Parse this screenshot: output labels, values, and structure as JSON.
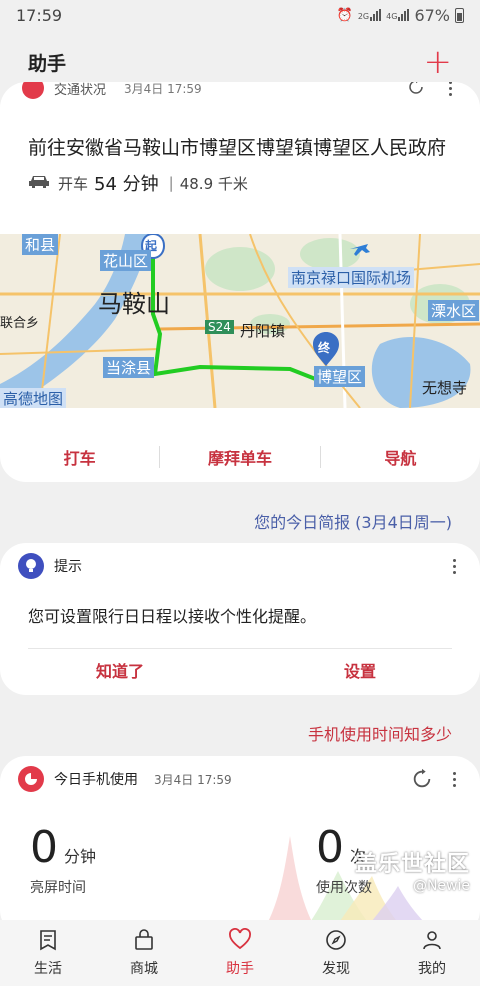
{
  "status_bar": {
    "time": "17:59",
    "battery": "67%",
    "sig1": "2G",
    "sig2": "4G"
  },
  "header": {
    "title": "助手",
    "add_icon": "add-circle-icon"
  },
  "traffic_card": {
    "category": "交通状况",
    "timestamp": "3月4日 17:59",
    "destination": "前往安徽省马鞍山市博望区博望镇博望区人民政府",
    "mode": "开车",
    "duration": "54 分钟",
    "distance": "48.9 千米",
    "map_labels": {
      "hexian": "和县",
      "huashanqu": "花山区",
      "maanshan": "马鞍山",
      "lukou": "南京禄口国际机场",
      "lishui": "溧水区",
      "lianhexiang": "联合乡",
      "s24": "S24",
      "danyang": "丹阳镇",
      "dangtu": "当涂县",
      "bowang": "博望区",
      "wuxiang": "无想寺",
      "gaode": "高德地图",
      "start": "起",
      "end": "终"
    },
    "actions": [
      "打车",
      "摩拜单车",
      "导航"
    ]
  },
  "briefing_link": "您的今日简报 (3月4日周一)",
  "tip_card": {
    "title": "提示",
    "text": "您可设置限行日日程以接收个性化提醒。",
    "actions": [
      "知道了",
      "设置"
    ]
  },
  "usage_link": "手机使用时间知多少",
  "usage_card": {
    "title": "今日手机使用",
    "timestamp": "3月4日 17:59",
    "screen_on_value": "0",
    "screen_on_unit": "分钟",
    "screen_on_label": "亮屏时间",
    "uses_value": "0",
    "uses_unit": "次",
    "uses_label": "使用次数"
  },
  "watermark": {
    "line1": "盖乐世社区",
    "line2": "@Newie"
  },
  "bottom_nav": [
    {
      "label": "生活",
      "icon": "life-icon"
    },
    {
      "label": "商城",
      "icon": "shopping-bag-icon"
    },
    {
      "label": "助手",
      "icon": "heart-icon"
    },
    {
      "label": "发现",
      "icon": "compass-icon"
    },
    {
      "label": "我的",
      "icon": "person-icon"
    }
  ],
  "colors": {
    "accent": "#e23a4a",
    "link_blue": "#4a5fa8",
    "route_green": "#22cc22"
  }
}
